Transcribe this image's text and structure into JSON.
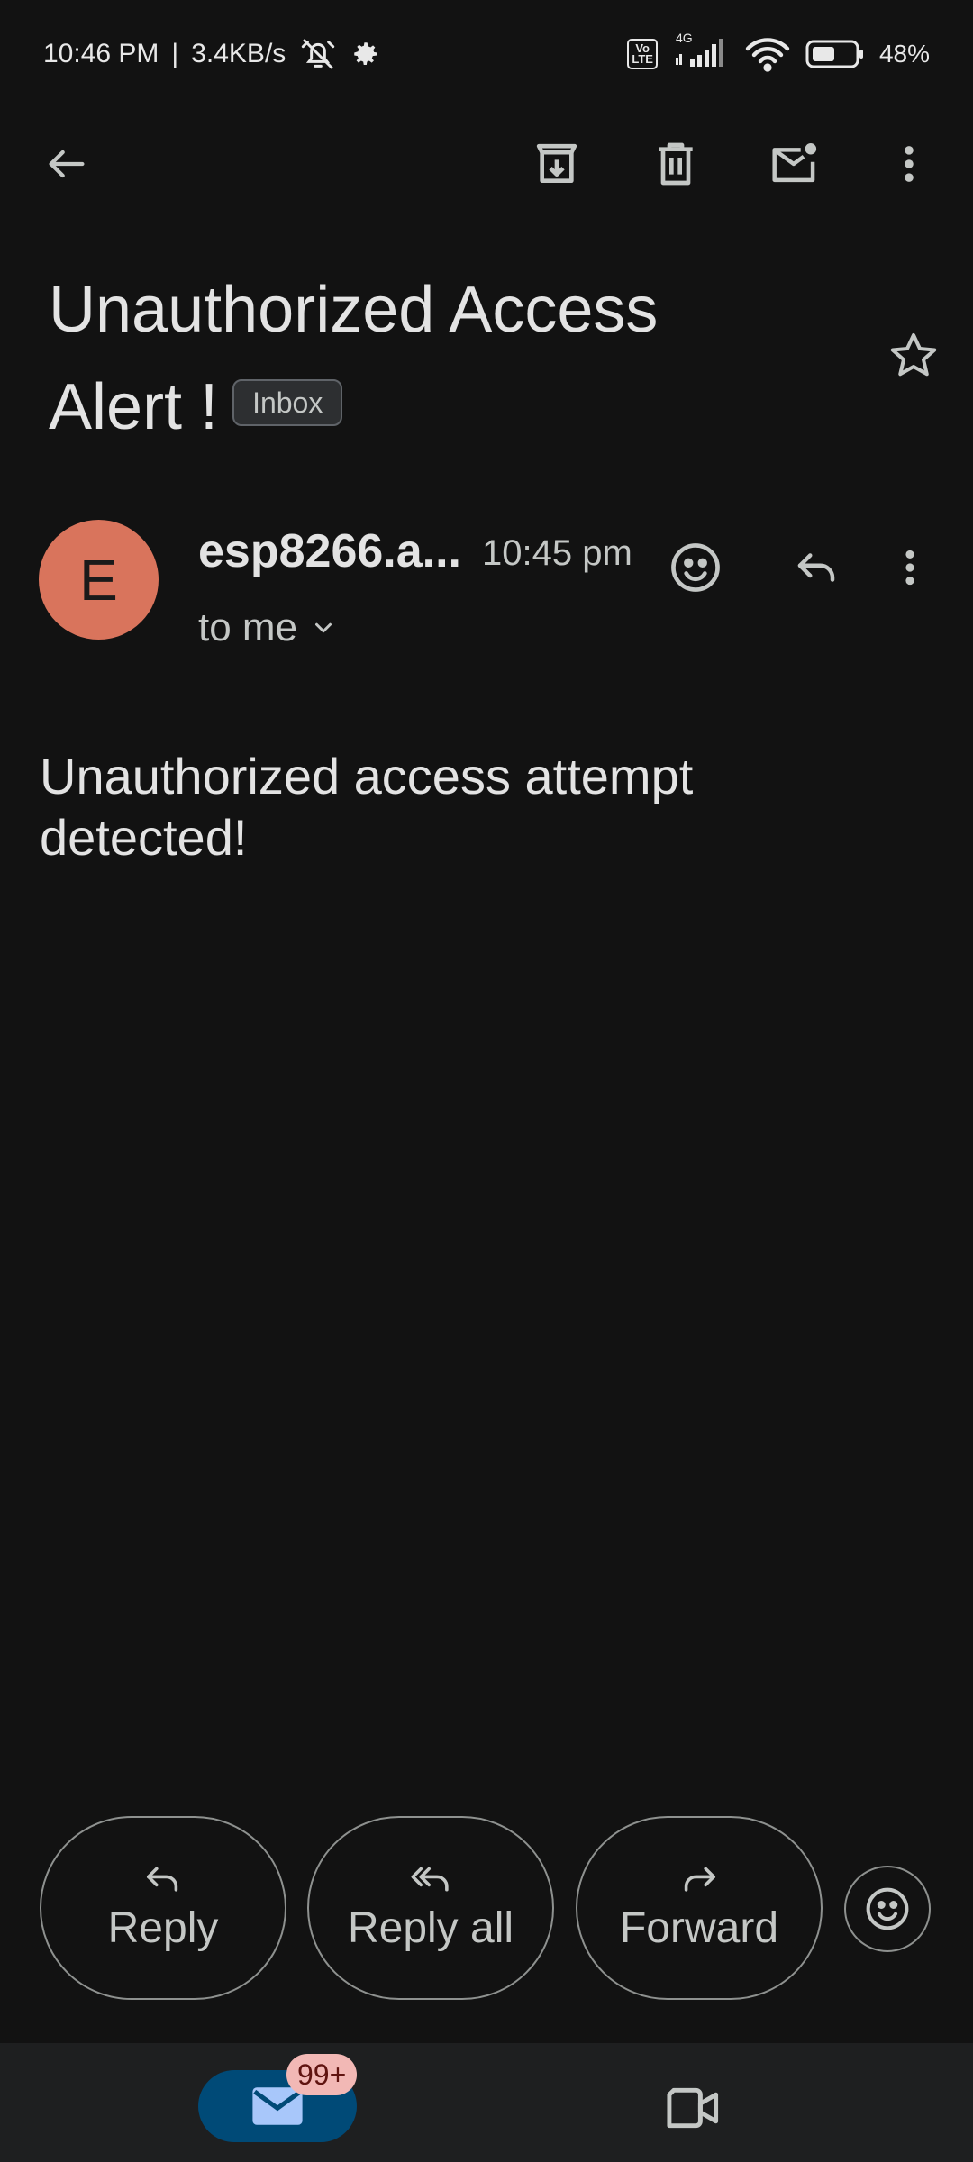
{
  "status_bar": {
    "time": "10:46 PM",
    "separator": "|",
    "net_speed": "3.4KB/s",
    "volte_top": "Vo",
    "volte_bottom": "LTE",
    "network": "4G",
    "battery": "48%"
  },
  "action_bar": {
    "icons": [
      "back-arrow-icon",
      "archive-icon",
      "delete-icon",
      "mark-unread-icon",
      "more-vert-icon"
    ]
  },
  "email": {
    "subject_line1": "Unauthorized Access",
    "subject_line2": "Alert !",
    "label": "Inbox",
    "sender_initial": "E",
    "sender_name": "esp8266.a...",
    "time": "10:45 pm",
    "recipient": "to me",
    "body_line1": "Unauthorized access attempt",
    "body_line2": "detected!"
  },
  "reply_bar": {
    "reply": "Reply",
    "reply_all": "Reply all",
    "forward": "Forward"
  },
  "bottom_nav": {
    "badge": "99+"
  },
  "colors": {
    "background": "#121212",
    "avatar": "#d9745c",
    "nav_active": "#004a77",
    "badge": "#f2b8b5"
  }
}
